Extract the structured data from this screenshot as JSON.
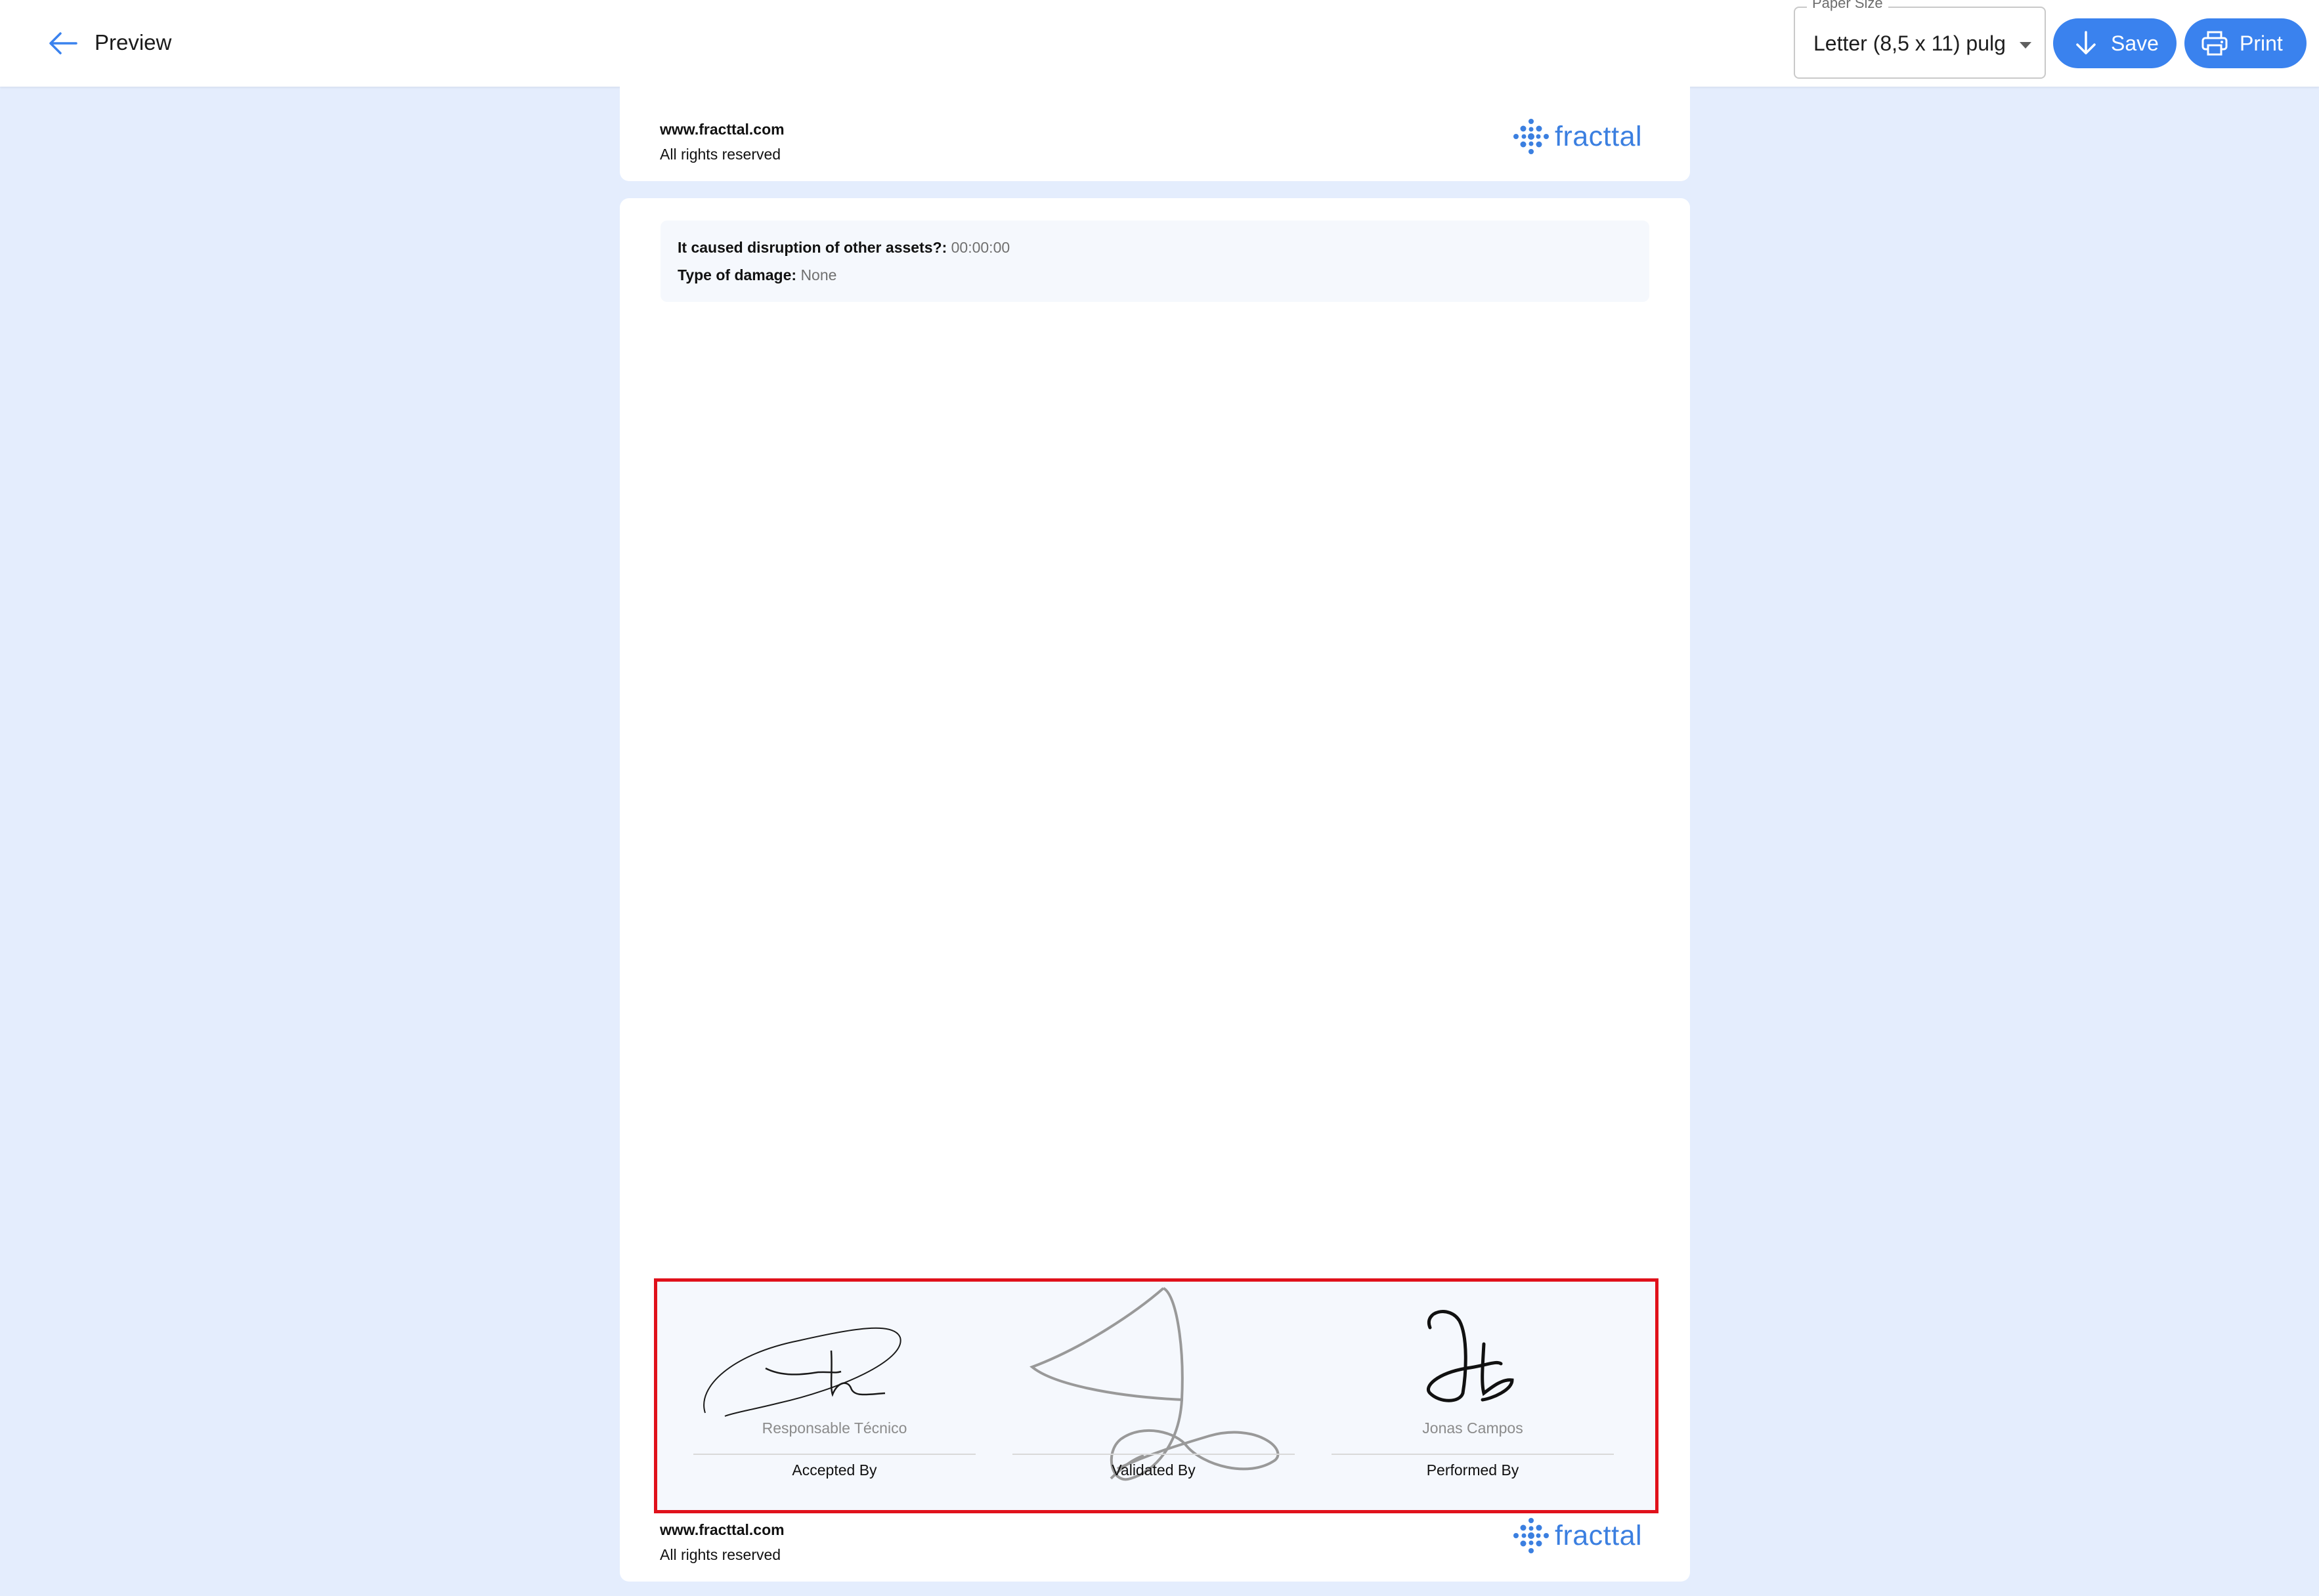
{
  "header": {
    "title": "Preview",
    "paper_size": {
      "legend": "Paper Size",
      "value": "Letter (8,5 x 11) pulg"
    },
    "save_label": "Save",
    "print_label": "Print"
  },
  "footer": {
    "website": "www.fracttal.com",
    "rights": "All rights reserved",
    "logo_text": "fracttal"
  },
  "details": [
    {
      "label": "It caused disruption of other assets?:",
      "value": "00:00:00"
    },
    {
      "label": "Type of damage:",
      "value": "None"
    }
  ],
  "signatures": [
    {
      "name": "Responsable Técnico",
      "role": "Accepted By"
    },
    {
      "name": "",
      "role": "Validated By"
    },
    {
      "name": "Jonas Campos",
      "role": "Performed By"
    }
  ],
  "colors": {
    "accent": "#3a82ee",
    "background": "#e4edfd",
    "highlight_border": "#e0111b"
  }
}
